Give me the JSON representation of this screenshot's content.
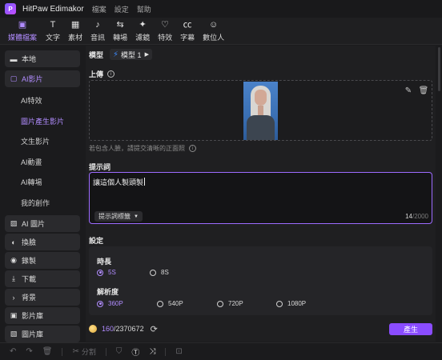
{
  "app": {
    "title": "HitPaw Edimakor",
    "menu": [
      "檔案",
      "設定",
      "幫助"
    ],
    "accent": "#b18cff",
    "brand_button": "#8a4cff"
  },
  "toolbar": [
    {
      "label": "媒體檔案",
      "icon": "media-icon"
    },
    {
      "label": "文字",
      "icon": "text-icon"
    },
    {
      "label": "素材",
      "icon": "assets-icon"
    },
    {
      "label": "音訊",
      "icon": "music-note-icon"
    },
    {
      "label": "轉場",
      "icon": "transition-icon"
    },
    {
      "label": "濾鏡",
      "icon": "filter-icon"
    },
    {
      "label": "特效",
      "icon": "effects-icon"
    },
    {
      "label": "字幕",
      "icon": "subtitle-icon"
    },
    {
      "label": "數位人",
      "icon": "digital-human-icon"
    }
  ],
  "sidebar": {
    "local": "本地",
    "ai_video": "AI影片",
    "subitems": [
      "AI特效",
      "圖片產生影片",
      "文生影片",
      "AI動畫",
      "AI轉場",
      "我的創作"
    ],
    "ai_image": "AI 圖片",
    "face_swap": "換臉",
    "record": "錄製",
    "download": "下載",
    "background": "背景",
    "video_library": "影片庫",
    "image_library": "圖片庫"
  },
  "main": {
    "model_label": "模型",
    "model_value": "模型 1",
    "upload_title": "上傳",
    "upload_hint": "若包含人臉，請提交清晰的正面照",
    "prompt_title": "提示詞",
    "prompt_text": "讓這個人製頭製",
    "prompt_tag_button": "提示詞標籤",
    "prompt_count": "14",
    "prompt_max": "/2000",
    "settings_title": "設定",
    "duration_label": "時長",
    "durations": [
      "5S",
      "8S"
    ],
    "duration_selected": "5S",
    "resolution_label": "解析度",
    "resolutions": [
      "360P",
      "540P",
      "720P",
      "1080P"
    ],
    "resolution_selected": "360P",
    "credits_current": "160",
    "credits_total": "/2370672",
    "generate_button": "產生"
  },
  "bottom": {
    "split_label": "分割"
  }
}
